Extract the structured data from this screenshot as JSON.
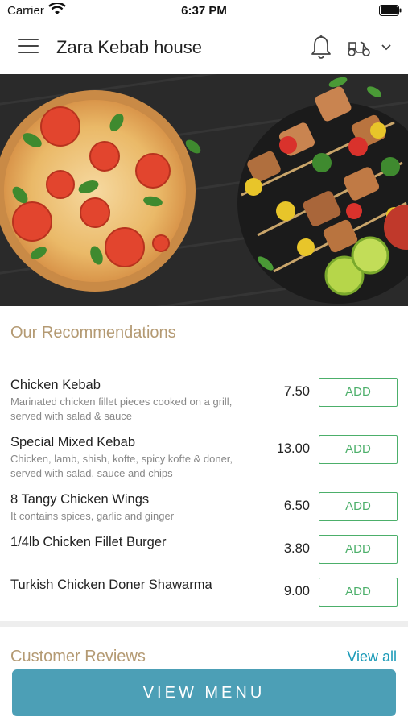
{
  "status_bar": {
    "carrier": "Carrier",
    "time": "6:37 PM"
  },
  "header": {
    "title": "Zara Kebab house"
  },
  "recommendations": {
    "title": "Our Recommendations",
    "add_label": "ADD",
    "items": [
      {
        "name": "Chicken Kebab",
        "desc": [
          "Marinated chicken fillet pieces cooked on a grill,",
          "served with salad & sauce"
        ],
        "price": "7.50"
      },
      {
        "name": "Special Mixed Kebab",
        "desc": [
          "Chicken, lamb, shish, kofte, spicy kofte & doner,",
          "served with salad, sauce and chips"
        ],
        "price": "13.00"
      },
      {
        "name": "8 Tangy Chicken Wings",
        "desc": [
          "It contains spices, garlic and ginger"
        ],
        "price": "6.50"
      },
      {
        "name": "1/4lb Chicken Fillet Burger",
        "desc": [],
        "price": "3.80"
      },
      {
        "name": "Turkish Chicken Doner Shawarma",
        "desc": [],
        "price": "9.00"
      }
    ]
  },
  "reviews": {
    "title": "Customer Reviews",
    "view_all": "View all"
  },
  "footer": {
    "button_label": "VIEW MENU"
  },
  "colors": {
    "accent_gold": "#b49a73",
    "add_green": "#4caf6a",
    "link_blue": "#1d9bb8",
    "button_blue": "#4c9fb6"
  },
  "icons": [
    "wifi-icon",
    "battery-icon",
    "hamburger-menu-icon",
    "bell-icon",
    "delivery-scooter-icon",
    "chevron-down-icon"
  ]
}
